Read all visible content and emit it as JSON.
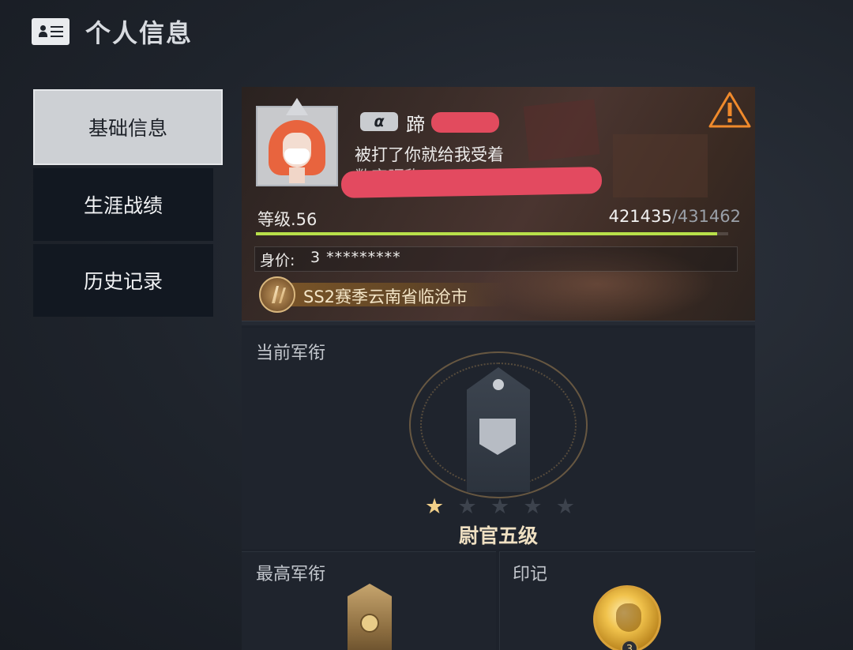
{
  "header": {
    "title": "个人信息",
    "icon": "profile-card-icon"
  },
  "sidebar": {
    "items": [
      {
        "label": "基础信息",
        "active": true
      },
      {
        "label": "生涯战绩",
        "active": false
      },
      {
        "label": "历史记录",
        "active": false
      }
    ]
  },
  "profile": {
    "tier_badge": "α",
    "name": "蹄",
    "signature": "被打了你就给我受着",
    "digital_nick": "数字昵称",
    "level_label": "等级.56",
    "exp_current": "421435",
    "exp_separator": "/",
    "exp_max": "431462",
    "exp_fraction": 0.9768,
    "worth_label": "身价:",
    "worth_value": "3 *********",
    "season_title": "SS2赛季云南省临沧市",
    "warning_icon": "warning-triangle-icon"
  },
  "current_rank": {
    "label": "当前军衔",
    "stars_total": 5,
    "stars_filled": 1,
    "star_glyph": "★",
    "rank_name": "尉官五级"
  },
  "highest_rank": {
    "label": "最高军衔"
  },
  "marks": {
    "label": "印记",
    "medal_level": "3"
  },
  "colors": {
    "exp_bar": "#b8e04a",
    "redaction": "#e34a60",
    "warning": "#f08a2c",
    "gold_text": "#efe0c2"
  }
}
